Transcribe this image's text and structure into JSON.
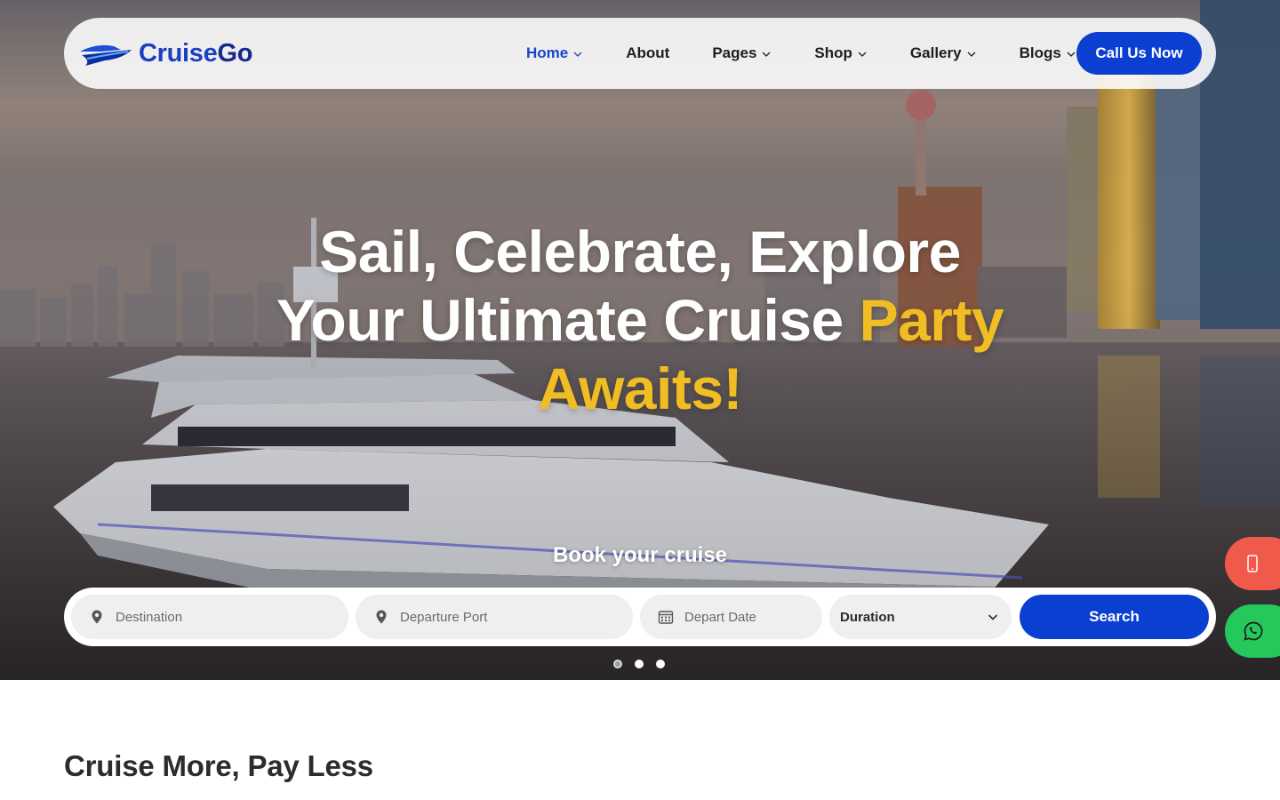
{
  "brand": {
    "name_part1": "Cruise",
    "name_part2": "Go",
    "primary_color": "#0b3fd1",
    "accent_color": "#f0bd22"
  },
  "nav": {
    "items": [
      {
        "label": "Home",
        "has_dropdown": true,
        "active": true
      },
      {
        "label": "About",
        "has_dropdown": false,
        "active": false
      },
      {
        "label": "Pages",
        "has_dropdown": true,
        "active": false
      },
      {
        "label": "Shop",
        "has_dropdown": true,
        "active": false
      },
      {
        "label": "Gallery",
        "has_dropdown": true,
        "active": false
      },
      {
        "label": "Blogs",
        "has_dropdown": true,
        "active": false
      }
    ],
    "cta_label": "Call Us Now"
  },
  "hero": {
    "line1": "Sail, Celebrate, Explore",
    "line2_plain": "Your Ultimate Cruise ",
    "line2_accent": "Party",
    "line3_accent": "Awaits!",
    "book_title": "Book your cruise",
    "slides": [
      {
        "active": true
      },
      {
        "active": false
      },
      {
        "active": false
      }
    ]
  },
  "search": {
    "destination_placeholder": "Destination",
    "departure_placeholder": "Departure Port",
    "date_placeholder": "Depart Date",
    "duration_label": "Duration",
    "search_label": "Search",
    "icons": {
      "destination": "map-pin-icon",
      "departure": "map-pin-icon",
      "date": "calendar-icon",
      "duration": "chevron-down-icon"
    }
  },
  "floating": {
    "phone_icon": "mobile-phone-icon",
    "whatsapp_icon": "whatsapp-icon",
    "phone_color": "#f05a4a",
    "whatsapp_color": "#25c85a"
  },
  "sections": {
    "deals_title": "Cruise More, Pay Less"
  }
}
